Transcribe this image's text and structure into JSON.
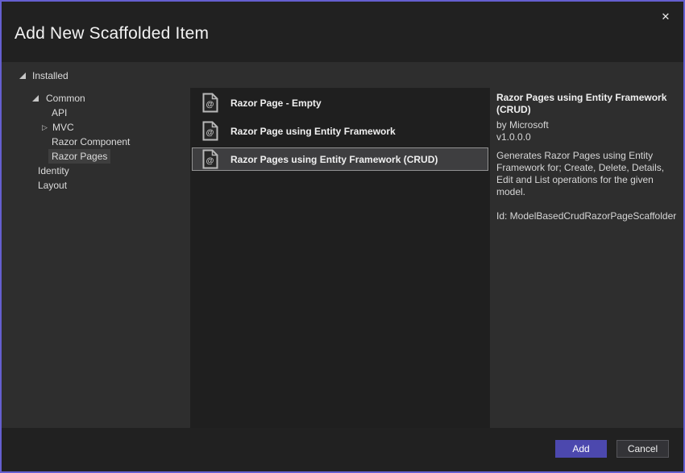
{
  "window": {
    "title": "Add New Scaffolded Item",
    "close_glyph": "✕"
  },
  "tree": {
    "items": [
      {
        "label": "Installed",
        "level": 0,
        "glyph": "expanded",
        "selected": false
      },
      {
        "label": "Common",
        "level": 1,
        "glyph": "expanded",
        "selected": false
      },
      {
        "label": "API",
        "level": 2,
        "glyph": null,
        "selected": false
      },
      {
        "label": "MVC",
        "level": 2,
        "glyph": "collapsed",
        "selected": false
      },
      {
        "label": "Razor Component",
        "level": 2,
        "glyph": null,
        "selected": false
      },
      {
        "label": "Razor Pages",
        "level": 2,
        "glyph": null,
        "selected": true
      },
      {
        "label": "Identity",
        "level": 1,
        "glyph": null,
        "selected": false
      },
      {
        "label": "Layout",
        "level": 1,
        "glyph": null,
        "selected": false
      }
    ]
  },
  "list": {
    "items": [
      {
        "label": "Razor Page - Empty",
        "icon": "razor-page-icon",
        "selected": false
      },
      {
        "label": "Razor Page using Entity Framework",
        "icon": "razor-page-icon",
        "selected": false
      },
      {
        "label": "Razor Pages using Entity Framework (CRUD)",
        "icon": "razor-page-icon",
        "selected": true
      }
    ]
  },
  "details": {
    "title": "Razor Pages using Entity Framework (CRUD)",
    "author": "by Microsoft",
    "version": "v1.0.0.0",
    "description": "Generates Razor Pages using Entity Framework for; Create, Delete, Details, Edit and List operations for the given model.",
    "id_line": "Id: ModelBasedCrudRazorPageScaffolder"
  },
  "footer": {
    "add_label": "Add",
    "cancel_label": "Cancel"
  },
  "colors": {
    "accent_border": "#655fd0",
    "add_button": "#4c48ae",
    "selection_border": "#929292",
    "panel_bg": "#2e2e2e",
    "list_bg": "#1f1f1f"
  }
}
